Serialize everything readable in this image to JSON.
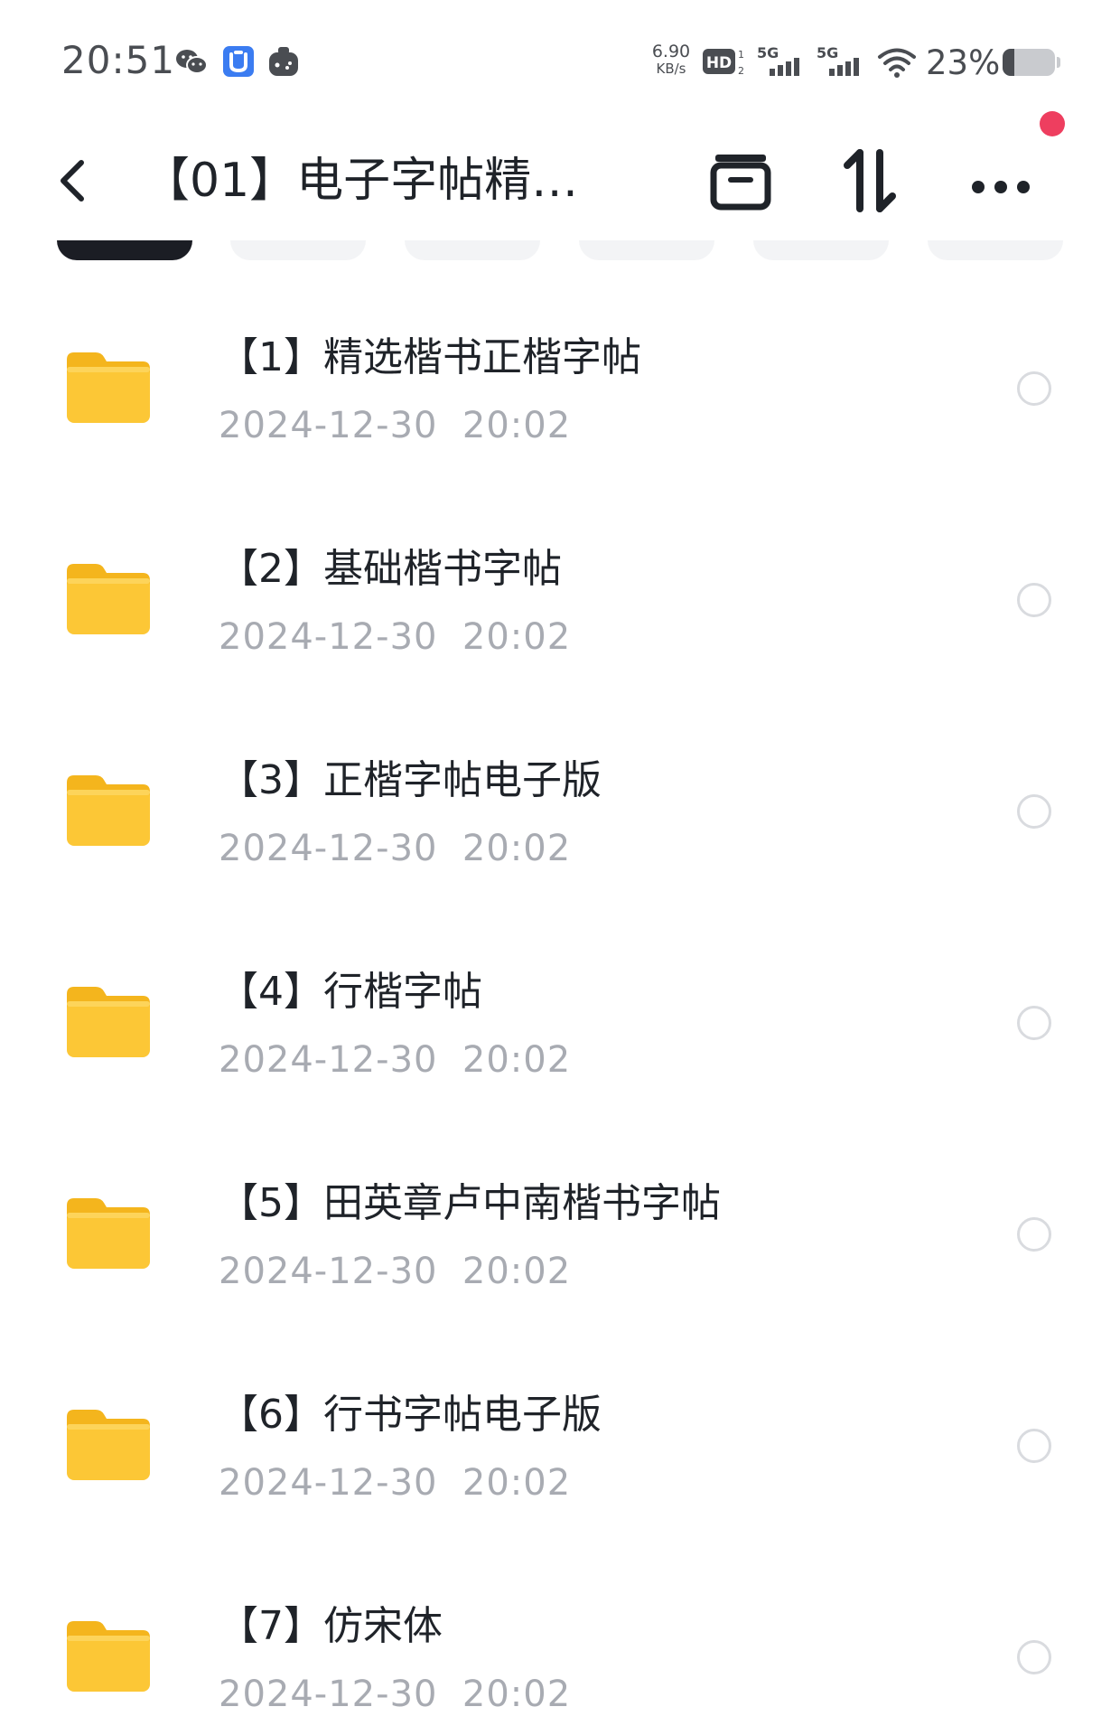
{
  "status_bar": {
    "time": "20:51",
    "icons": [
      "wechat-icon",
      "app-shield-icon",
      "game-controller-icon",
      "hd-icon",
      "signal-5g-icon",
      "signal-5g-icon",
      "wifi-icon"
    ],
    "net_speed_value": "6.90",
    "net_speed_unit": "KB/s",
    "hd_label": "HD",
    "network_label_1": "5G",
    "network_label_2": "5G",
    "battery_percent": "23%",
    "battery_level": 0.23
  },
  "header": {
    "title": "【01】电子字帖精…",
    "back_icon": "chevron-left-icon",
    "actions": [
      "archive-icon",
      "sort-icon",
      "more-icon"
    ]
  },
  "files": [
    {
      "name": "【1】精选楷书正楷字帖",
      "date": "2024-12-30  20:02",
      "icon": "folder-icon"
    },
    {
      "name": "【2】基础楷书字帖",
      "date": "2024-12-30  20:02",
      "icon": "folder-icon"
    },
    {
      "name": "【3】正楷字帖电子版",
      "date": "2024-12-30  20:02",
      "icon": "folder-icon"
    },
    {
      "name": "【4】行楷字帖",
      "date": "2024-12-30  20:02",
      "icon": "folder-icon"
    },
    {
      "name": "【5】田英章卢中南楷书字帖",
      "date": "2024-12-30  20:02",
      "icon": "folder-icon"
    },
    {
      "name": "【6】行书字帖电子版",
      "date": "2024-12-30  20:02",
      "icon": "folder-icon"
    },
    {
      "name": "【7】仿宋体",
      "date": "2024-12-30  20:02",
      "icon": "folder-icon"
    }
  ],
  "colors": {
    "folder": "#fcc736",
    "folder_tab": "#f4b51d",
    "notification_dot": "#ee3e5f",
    "active_tab": "#1b1d24",
    "date_text": "#a8abb2"
  }
}
